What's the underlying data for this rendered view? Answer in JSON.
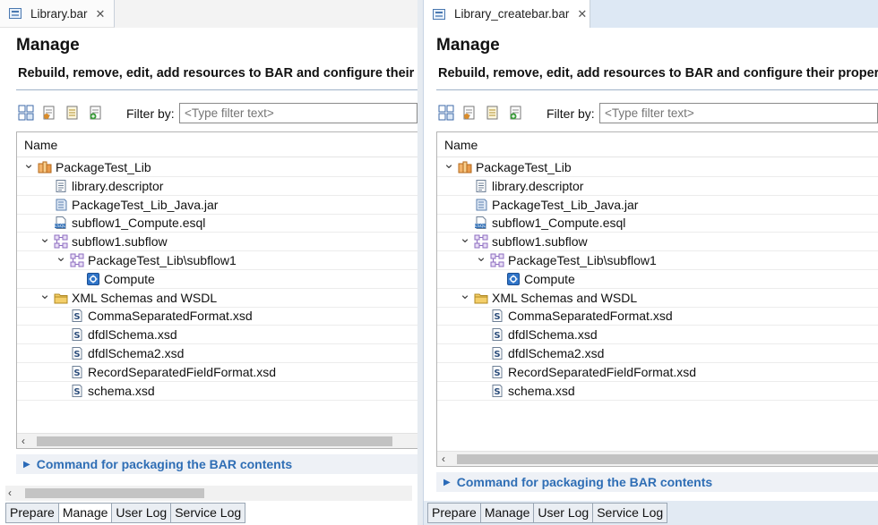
{
  "editors": [
    {
      "tab_title": "Library.bar",
      "heading": "Manage",
      "subheading": "Rebuild, remove, edit, add resources to BAR and configure their properties",
      "filter_label": "Filter by:",
      "filter_placeholder": "<Type filter text>",
      "column_name": "Name",
      "tree": [
        "PackageTest_Lib",
        "library.descriptor",
        "PackageTest_Lib_Java.jar",
        "subflow1_Compute.esql",
        "subflow1.subflow",
        "PackageTest_Lib\\subflow1",
        "Compute",
        "XML Schemas and WSDL",
        "CommaSeparatedFormat.xsd",
        "dfdlSchema.xsd",
        "dfdlSchema2.xsd",
        "RecordSeparatedFieldFormat.xsd",
        "schema.xsd"
      ],
      "section_title": "Command for packaging the BAR contents",
      "bottom_tabs": [
        "Prepare",
        "Manage",
        "User Log",
        "Service Log"
      ]
    },
    {
      "tab_title": "Library_createbar.bar",
      "heading": "Manage",
      "subheading": "Rebuild, remove, edit, add resources to BAR and configure their properties",
      "filter_label": "Filter by:",
      "filter_placeholder": "<Type filter text>",
      "column_name": "Name",
      "tree": [
        "PackageTest_Lib",
        "library.descriptor",
        "PackageTest_Lib_Java.jar",
        "subflow1_Compute.esql",
        "subflow1.subflow",
        "PackageTest_Lib\\subflow1",
        "Compute",
        "XML Schemas and WSDL",
        "CommaSeparatedFormat.xsd",
        "dfdlSchema.xsd",
        "dfdlSchema2.xsd",
        "RecordSeparatedFieldFormat.xsd",
        "schema.xsd"
      ],
      "section_title": "Command for packaging the BAR contents",
      "bottom_tabs": [
        "Prepare",
        "Manage",
        "User Log",
        "Service Log"
      ]
    }
  ],
  "colors": {
    "section_text": "#2f6eb5",
    "active_tab_bg": "#dde8f4",
    "rule": "#9fb2c8"
  }
}
